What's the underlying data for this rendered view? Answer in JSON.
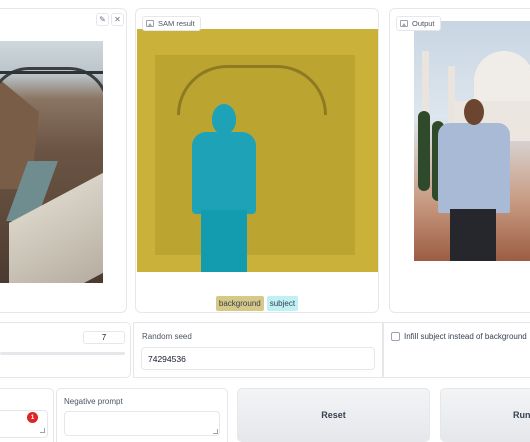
{
  "input_panel": {
    "edit_icon": "pencil-icon",
    "close_icon": "close-icon"
  },
  "sam_panel": {
    "label": "SAM result",
    "icon": "image-icon",
    "legend": [
      "background",
      "subject"
    ],
    "colors": {
      "background": "#c9b13a",
      "subject": "#1ea2b8"
    }
  },
  "output_panel": {
    "label": "Output",
    "icon": "image-icon"
  },
  "controls": {
    "slider_value": "7",
    "seed_label": "Random seed",
    "seed_value": "74294536",
    "checkbox_label": "Infill subject instead of background",
    "checkbox_checked": false
  },
  "prompts": {
    "negative_label": "Negative prompt",
    "negative_value": "",
    "badge_count": "1"
  },
  "buttons": {
    "reset": "Reset",
    "run": "Run"
  }
}
